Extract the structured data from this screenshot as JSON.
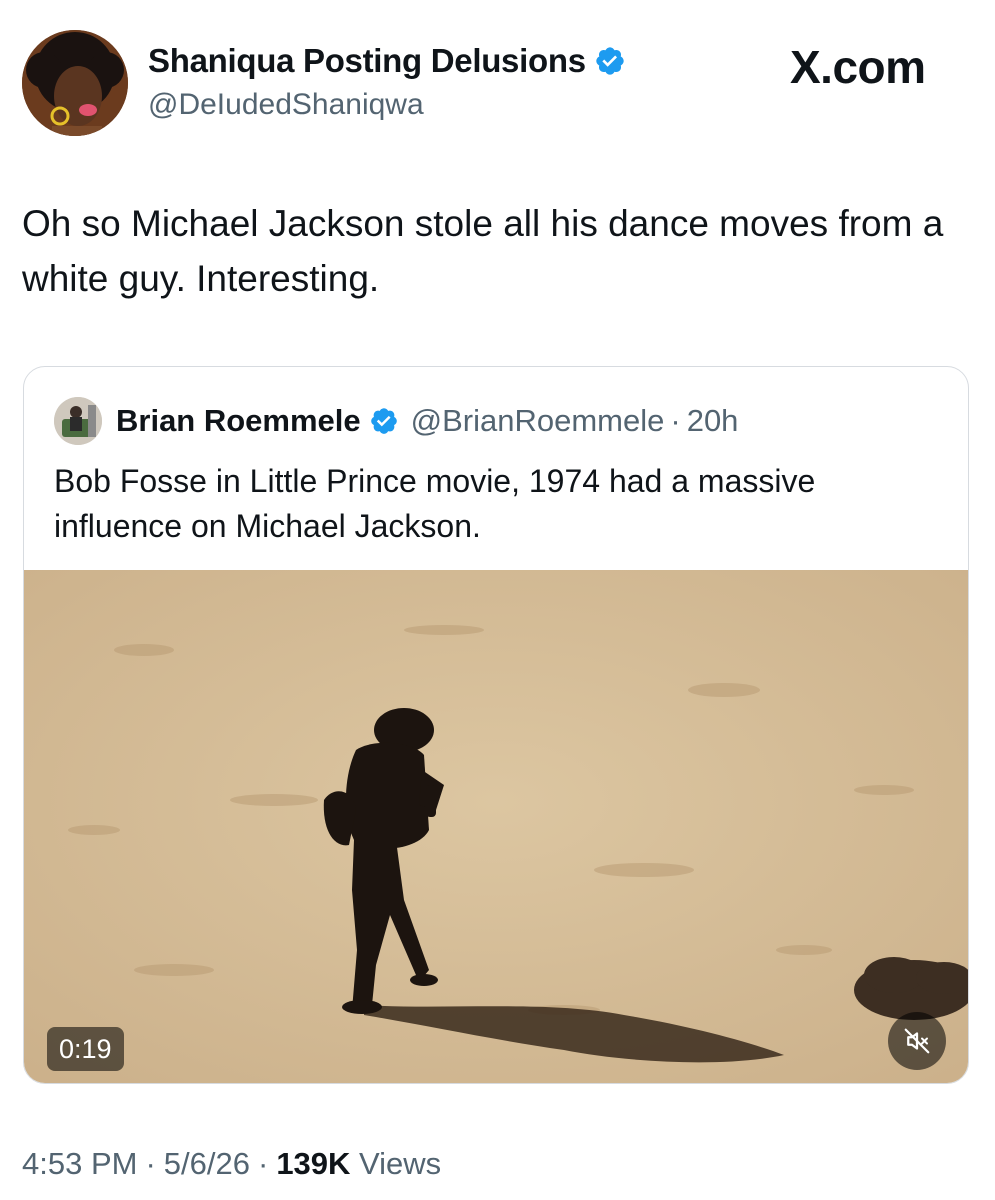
{
  "author": {
    "display_name": "Shaniqua Posting Delusions",
    "handle": "@DeIudedShaniqwa",
    "verified_icon": "verified-badge-icon",
    "avatar_icon": "avatar"
  },
  "brand": {
    "label": "X.com"
  },
  "tweet": {
    "text": "Oh so Michael Jackson stole all his dance moves from a white guy. Interesting."
  },
  "quote": {
    "display_name": "Brian Roemmele",
    "handle": "@BrianRoemmele",
    "separator": "·",
    "time": "20h",
    "text": "Bob Fosse in Little Prince movie, 1974 had a massive influence on Michael Jackson.",
    "video": {
      "duration": "0:19",
      "mute_icon": "speaker-muted-icon"
    }
  },
  "footer": {
    "time": "4:53 PM",
    "sep1": "·",
    "date": "5/6/26",
    "sep2": "·",
    "views_count": "139K",
    "views_label": "Views"
  },
  "colors": {
    "text_primary": "#0f1419",
    "text_secondary": "#536471",
    "verified_blue": "#1d9bf0",
    "card_border": "#d7dbe0",
    "sand": "#d8c19c"
  }
}
